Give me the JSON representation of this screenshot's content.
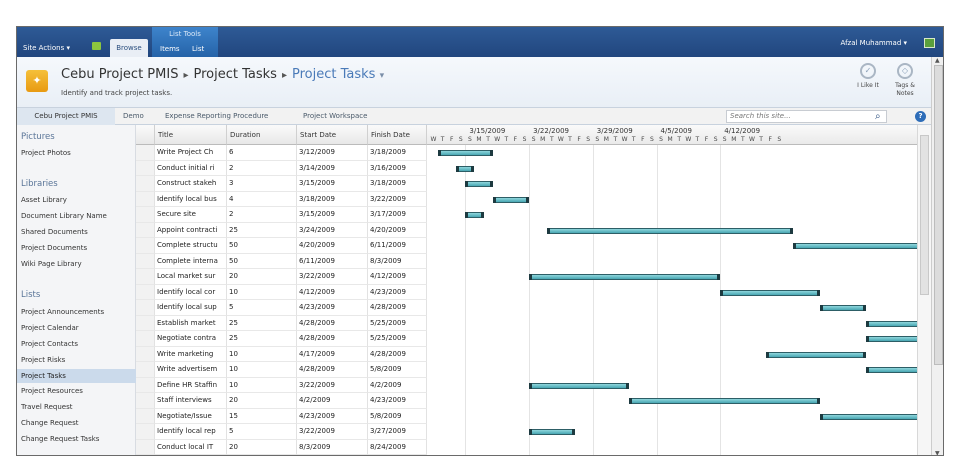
{
  "ribbon": {
    "site_actions": "Site Actions ▾",
    "browse": "Browse",
    "list_tools": "List Tools",
    "items": "Items",
    "list": "List",
    "user": "Afzal Muhammad ▾"
  },
  "header": {
    "site": "Cebu Project PMIS",
    "crumb1": "Project Tasks",
    "crumb2": "Project Tasks",
    "dropdown": "▾",
    "subtitle": "Identify and track project tasks.",
    "i_like_it": "I Like It",
    "tags_notes": "Tags & Notes"
  },
  "topnav": {
    "items": [
      "Cebu Project PMIS",
      "Demo",
      "Expense Reporting Procedure",
      "Project Workspace"
    ],
    "search_placeholder": "Search this site...",
    "search_icon": "⌕",
    "help": "?"
  },
  "quicklaunch": {
    "pictures_heading": "Pictures",
    "pictures": [
      "Project Photos"
    ],
    "libraries_heading": "Libraries",
    "libraries": [
      "Asset Library",
      "Document Library Name",
      "Shared Documents",
      "Project Documents",
      "Wiki Page Library"
    ],
    "lists_heading": "Lists",
    "lists": [
      "Project Announcements",
      "Project Calendar",
      "Project Contacts",
      "Project Risks",
      "Project Tasks",
      "Project Resources",
      "Travel Request",
      "Change Request",
      "Change Request Tasks"
    ]
  },
  "grid": {
    "headers": {
      "title": "Title",
      "duration": "Duration",
      "start": "Start Date",
      "finish": "Finish Date"
    },
    "rows": [
      [
        "Write Project Ch",
        "6",
        "3/12/2009",
        "3/18/2009"
      ],
      [
        "Conduct initial ri",
        "2",
        "3/14/2009",
        "3/16/2009"
      ],
      [
        "Construct stakeh",
        "3",
        "3/15/2009",
        "3/18/2009"
      ],
      [
        "Identify local bus",
        "4",
        "3/18/2009",
        "3/22/2009"
      ],
      [
        "Secure site",
        "2",
        "3/15/2009",
        "3/17/2009"
      ],
      [
        "Appoint contracti",
        "25",
        "3/24/2009",
        "4/20/2009"
      ],
      [
        "Complete structu",
        "50",
        "4/20/2009",
        "6/11/2009"
      ],
      [
        "Complete interna",
        "50",
        "6/11/2009",
        "8/3/2009"
      ],
      [
        "Local market sur",
        "20",
        "3/22/2009",
        "4/12/2009"
      ],
      [
        "Identify local cor",
        "10",
        "4/12/2009",
        "4/23/2009"
      ],
      [
        "Identify local sup",
        "5",
        "4/23/2009",
        "4/28/2009"
      ],
      [
        "Establish market",
        "25",
        "4/28/2009",
        "5/25/2009"
      ],
      [
        "Negotiate contra",
        "25",
        "4/28/2009",
        "5/25/2009"
      ],
      [
        "Write marketing",
        "10",
        "4/17/2009",
        "4/28/2009"
      ],
      [
        "Write advertisem",
        "10",
        "4/28/2009",
        "5/8/2009"
      ],
      [
        "Define HR Staffin",
        "10",
        "3/22/2009",
        "4/2/2009"
      ],
      [
        "Staff interviews",
        "20",
        "4/2/2009",
        "4/23/2009"
      ],
      [
        "Negotiate/Issue",
        "15",
        "4/23/2009",
        "5/8/2009"
      ],
      [
        "Identify local rep",
        "5",
        "3/22/2009",
        "3/27/2009"
      ],
      [
        "Conduct local IT",
        "20",
        "8/3/2009",
        "8/24/2009"
      ]
    ]
  },
  "gantt": {
    "weeks": [
      "3/15/2009",
      "3/22/2009",
      "3/29/2009",
      "4/5/2009",
      "4/12/2009"
    ],
    "lead_days": [
      "W",
      "T",
      "F",
      "S"
    ],
    "week_days": [
      "S",
      "M",
      "T",
      "W",
      "T",
      "F",
      "S"
    ]
  }
}
